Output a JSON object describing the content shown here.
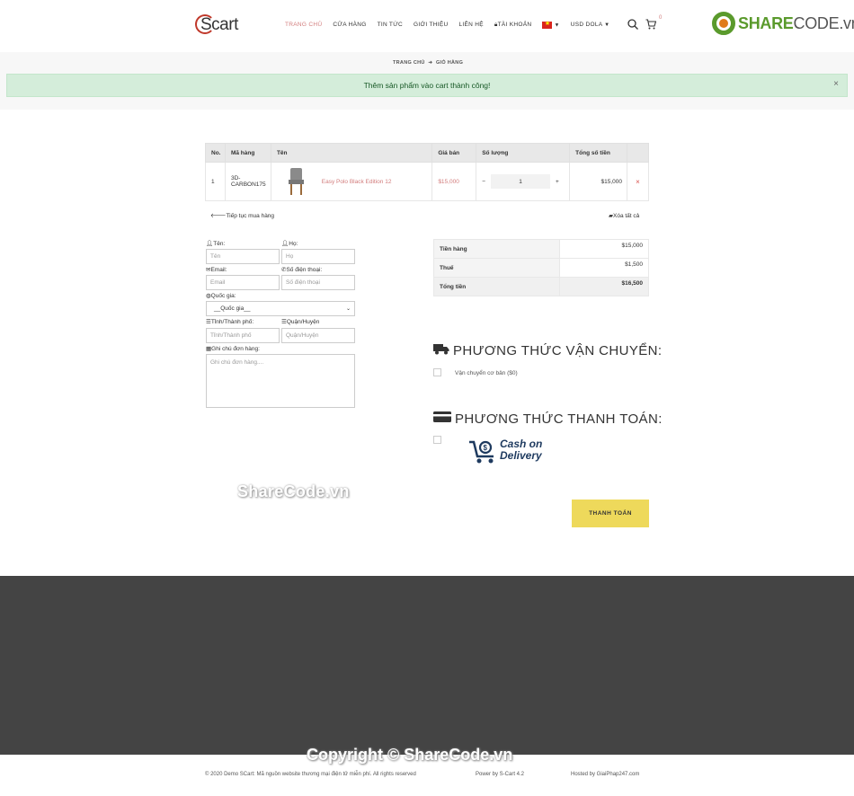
{
  "header": {
    "logo_text": "Scart",
    "nav": [
      {
        "label": "TRANG CHỦ",
        "active": true
      },
      {
        "label": "CỬA HÀNG",
        "active": false
      },
      {
        "label": "TIN TỨC",
        "active": false
      },
      {
        "label": "GIỚI THIỆU",
        "active": false
      },
      {
        "label": "LIÊN HỆ",
        "active": false
      },
      {
        "label": "TÀI KHOẢN",
        "active": false
      }
    ],
    "currency": "USD DOLA",
    "cart_count": "0",
    "brand_share": "SHARE",
    "brand_code": "CODE.vn"
  },
  "breadcrumb": {
    "home": "TRANG CHỦ",
    "current": "GIỎ HÀNG"
  },
  "alert": {
    "message": "Thêm sản phẩm vào cart thành công!",
    "close": "×"
  },
  "cart_table": {
    "headers": [
      "No.",
      "Mã hàng",
      "Tên",
      "Giá bán",
      "Số lượng",
      "Tổng số tiền"
    ],
    "rows": [
      {
        "no": "1",
        "sku_line1": "3D-",
        "sku_line2": "CARBON175",
        "name": "Easy Polo Black Edition 12",
        "price": "$15,000",
        "qty": "1",
        "total": "$15,000",
        "remove": "×"
      }
    ]
  },
  "actions": {
    "continue": "Tiếp tục mua hàng",
    "clear_all": "Xóa tất cả"
  },
  "form": {
    "first_name_label": "Tên:",
    "first_name_placeholder": "Tên",
    "last_name_label": "Họ:",
    "last_name_placeholder": "Họ",
    "email_label": "Email:",
    "email_placeholder": "Email",
    "phone_label": "Số điện thoại:",
    "phone_placeholder": "Số điện thoại",
    "country_label": "Quốc gia:",
    "country_value": "__Quốc gia__",
    "city_label": "Tỉnh/Thành phố:",
    "city_placeholder": "Tỉnh/Thành phố",
    "district_label": "Quận/Huyện",
    "district_placeholder": "Quận/Huyện",
    "note_label": "Ghi chú đơn hàng:",
    "note_placeholder": "Ghi chú đơn hàng...."
  },
  "totals": [
    {
      "label": "Tiền hàng",
      "value": "$15,000"
    },
    {
      "label": "Thuế",
      "value": "$1,500"
    },
    {
      "label": "Tổng tiền",
      "value": "$16,500"
    }
  ],
  "shipping": {
    "title": "PHƯƠNG THỨC VẬN CHUYỂN:",
    "option": "Vận chuyển cơ bản ($0)"
  },
  "payment": {
    "title": "PHƯƠNG THỨC THANH TOÁN:",
    "cod_line1": "Cash on",
    "cod_line2": "Delivery"
  },
  "checkout_label": "THANH TOÁN",
  "watermark": {
    "text": "ShareCode.vn",
    "copyright": "Copyright © ShareCode.vn"
  },
  "footer": {
    "left": "© 2020 Demo SCart: Mã nguồn website thương mại điện tử miễn phí. All rights reserved",
    "middle": "Power by S-Cart 4.2",
    "right": "Hosted by GiaiPhap247.com"
  },
  "colors": {
    "accent": "#d27c7c",
    "checkout": "#eed95b",
    "alert_bg": "#d4edda",
    "footer_bg": "#444444"
  }
}
